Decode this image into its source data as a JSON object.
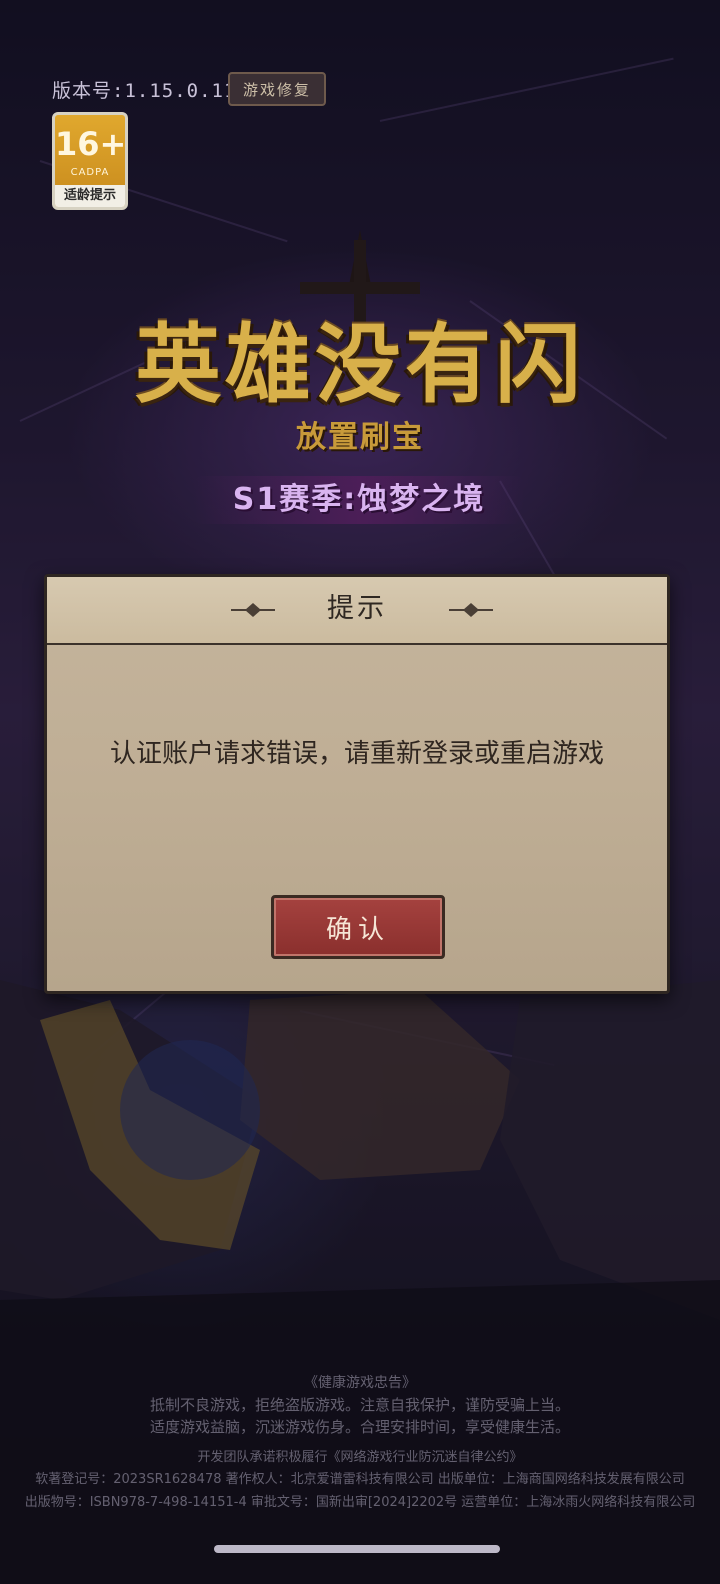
{
  "header": {
    "version": "版本号:1.15.0.111",
    "repair_label": "游戏修复"
  },
  "age_badge": {
    "rating": "16+",
    "org": "CADPA",
    "caption": "适龄提示"
  },
  "logo": {
    "title": "英雄没有闪",
    "subtitle": "放置刷宝",
    "season": "S1赛季:蚀梦之境"
  },
  "dialog": {
    "title": "提示",
    "message": "认证账户请求错误，请重新登录或重启游戏",
    "confirm_label": "确认"
  },
  "footer": {
    "line1": "《健康游戏忠告》",
    "line2": "抵制不良游戏，拒绝盗版游戏。注意自我保护，谨防受骗上当。",
    "line3": "适度游戏益脑，沉迷游戏伤身。合理安排时间，享受健康生活。",
    "line4": "开发团队承诺积极履行《网络游戏行业防沉迷自律公约》",
    "line5": "软著登记号：2023SR1628478 著作权人：北京爱谱雷科技有限公司 出版单位：上海商国网络科技发展有限公司",
    "line6": "出版物号：ISBN978-7-498-14151-4 审批文号：国新出审[2024]2202号 运营单位：上海冰雨火网络科技有限公司"
  },
  "colors": {
    "dialog_bg": "#bfae95",
    "confirm_bg": "#9a3a37",
    "title_gold": "#d8b04a"
  }
}
